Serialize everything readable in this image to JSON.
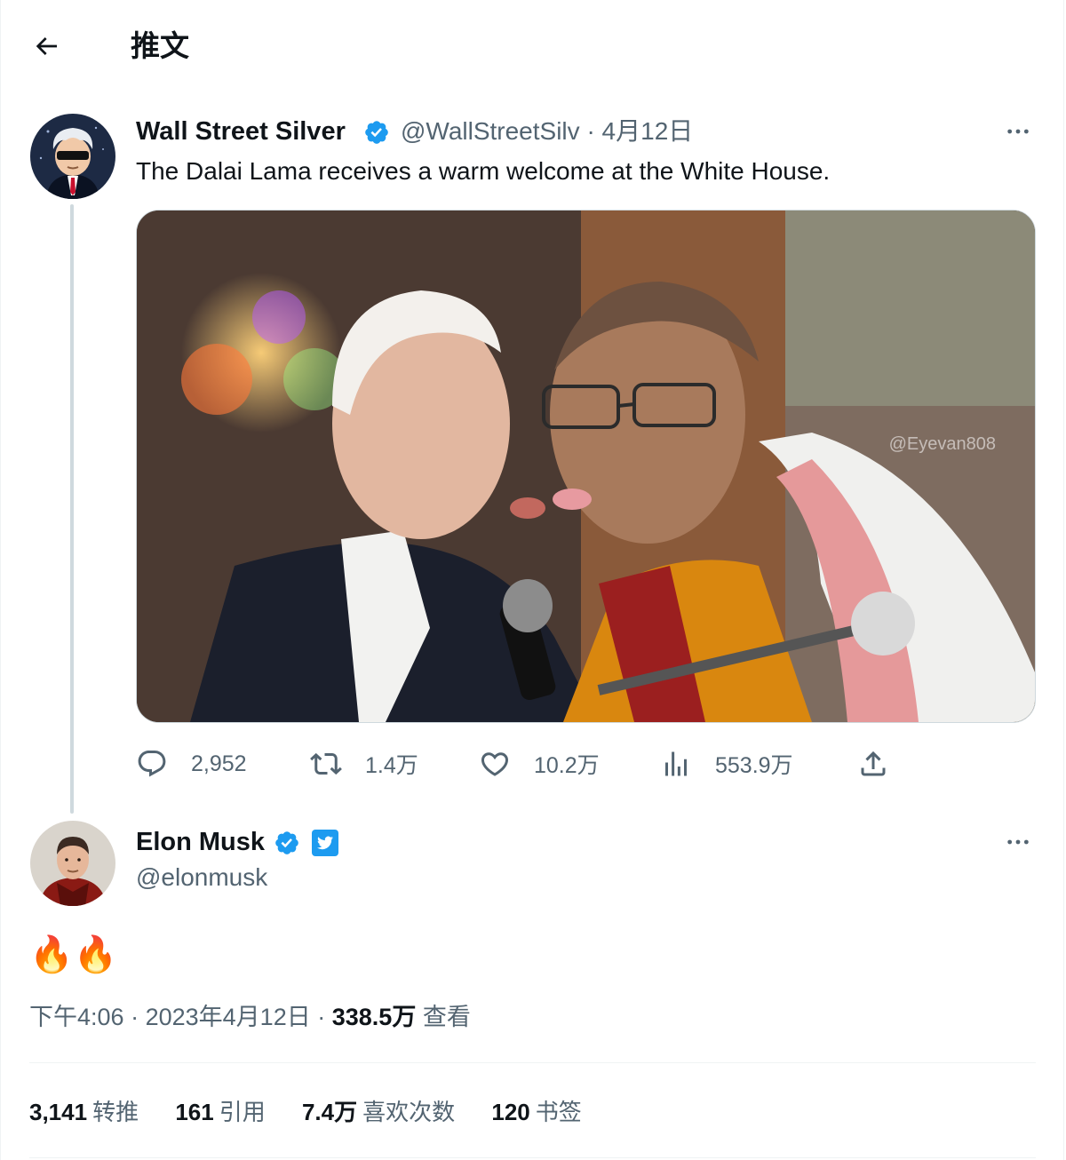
{
  "header": {
    "title": "推文"
  },
  "parent_tweet": {
    "name": "Wall Street Silver",
    "handle": "@WallStreetSilv",
    "separator": "·",
    "date": "4月12日",
    "text": "The Dalai Lama receives a warm welcome at the White House.",
    "media_watermark": "@Eyevan808",
    "actions": {
      "replies": "2,952",
      "retweets": "1.4万",
      "likes": "10.2万",
      "views": "553.9万"
    }
  },
  "main_tweet": {
    "name": "Elon Musk",
    "handle": "@elonmusk",
    "text": "🔥🔥",
    "meta": {
      "time": "下午4:06",
      "sep": "·",
      "date": "2023年4月12日",
      "views_count": "338.5万",
      "views_label": "查看"
    },
    "stats": [
      {
        "num": "3,141",
        "label": "转推"
      },
      {
        "num": "161",
        "label": "引用"
      },
      {
        "num": "7.4万",
        "label": "喜欢次数"
      },
      {
        "num": "120",
        "label": "书签"
      }
    ]
  },
  "colors": {
    "verified": "#1d9bf0",
    "secondary_text": "#536471",
    "divider": "#eff3f4"
  }
}
